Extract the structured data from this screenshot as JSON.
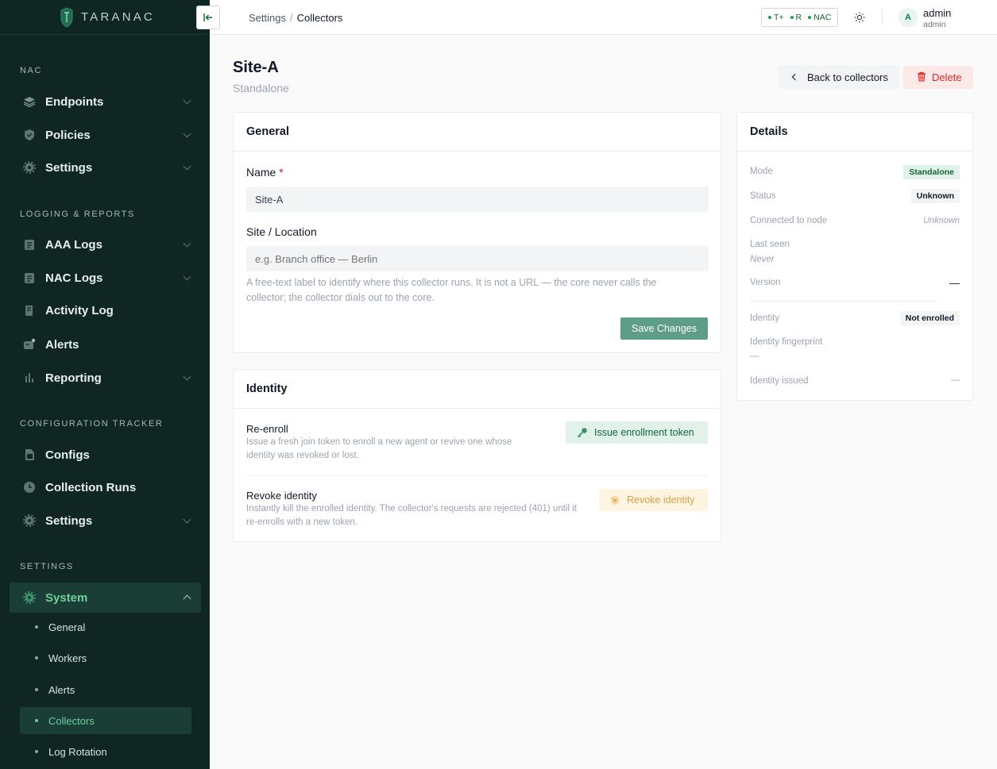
{
  "brand": {
    "name": "TARANAC"
  },
  "sidebar": {
    "sections": [
      {
        "title": "NAC"
      },
      {
        "title": "LOGGING & REPORTS"
      },
      {
        "title": "CONFIGURATION TRACKER"
      },
      {
        "title": "SETTINGS"
      }
    ],
    "items": [
      {
        "label": "Endpoints",
        "icon": "layers-icon"
      },
      {
        "label": "Policies",
        "icon": "shield-check-icon"
      },
      {
        "label": "Settings",
        "icon": "gear-icon"
      },
      {
        "label": "AAA Logs",
        "icon": "log-book-icon"
      },
      {
        "label": "NAC Logs",
        "icon": "log-book-icon"
      },
      {
        "label": "Activity Log",
        "icon": "scroll-icon"
      },
      {
        "label": "Alerts",
        "icon": "alert-message-icon"
      },
      {
        "label": "Reporting",
        "icon": "bar-chart-icon"
      },
      {
        "label": "Configs",
        "icon": "file-icon"
      },
      {
        "label": "Collection Runs",
        "icon": "clock-icon"
      },
      {
        "label": "Settings",
        "icon": "gear-icon"
      },
      {
        "label": "System",
        "icon": "gear-icon"
      }
    ],
    "system_sub": [
      {
        "label": "General"
      },
      {
        "label": "Workers"
      },
      {
        "label": "Alerts"
      },
      {
        "label": "Collectors"
      },
      {
        "label": "Log Rotation"
      }
    ]
  },
  "topbar": {
    "breadcrumb_parent": "Settings",
    "breadcrumb_sep": "/",
    "breadcrumb_current": "Collectors",
    "modules": [
      "T+",
      "R",
      "NAC"
    ],
    "user_initial": "A",
    "user_name": "admin",
    "user_role": "admin"
  },
  "page": {
    "title": "Site-A",
    "subtitle": "Standalone",
    "back_label": "Back to collectors",
    "delete_label": "Delete"
  },
  "general": {
    "heading": "General",
    "name_label": "Name",
    "name_required": "*",
    "name_value": "Site-A",
    "site_label": "Site / Location",
    "site_placeholder": "e.g. Branch office — Berlin",
    "site_help": "A free-text label to identify where this collector runs. It is not a URL — the core never calls the collector; the collector dials out to the core.",
    "save_label": "Save Changes"
  },
  "identity": {
    "heading": "Identity",
    "reenroll_title": "Re-enroll",
    "reenroll_desc": "Issue a fresh join token to enroll a new agent or revive one whose identity was revoked or lost.",
    "token_label": "Issue enrollment token",
    "revoke_title": "Revoke identity",
    "revoke_desc": "Instantly kill the enrolled identity. The collector's requests are rejected (401) until it re-enrolls with a new token.",
    "revoke_label": "Revoke identity"
  },
  "details": {
    "heading": "Details",
    "mode_label": "Mode",
    "mode_value": "Standalone",
    "status_label": "Status",
    "status_value": "Unknown",
    "node_label": "Connected to node",
    "node_value": "Unknown",
    "last_seen_label": "Last seen",
    "last_seen_value": "Never",
    "version_label": "Version",
    "version_value": "—",
    "identity_label": "Identity",
    "identity_value": "Not enrolled",
    "fingerprint_label": "Identity fingerprint",
    "fingerprint_value": "—",
    "issued_label": "Identity issued",
    "issued_value": "—"
  },
  "colors": {
    "sidebar_bg": "#102622",
    "accent_green": "#6fcf9f",
    "save_button": "#5e9e88",
    "delete_red": "#dc2626"
  }
}
